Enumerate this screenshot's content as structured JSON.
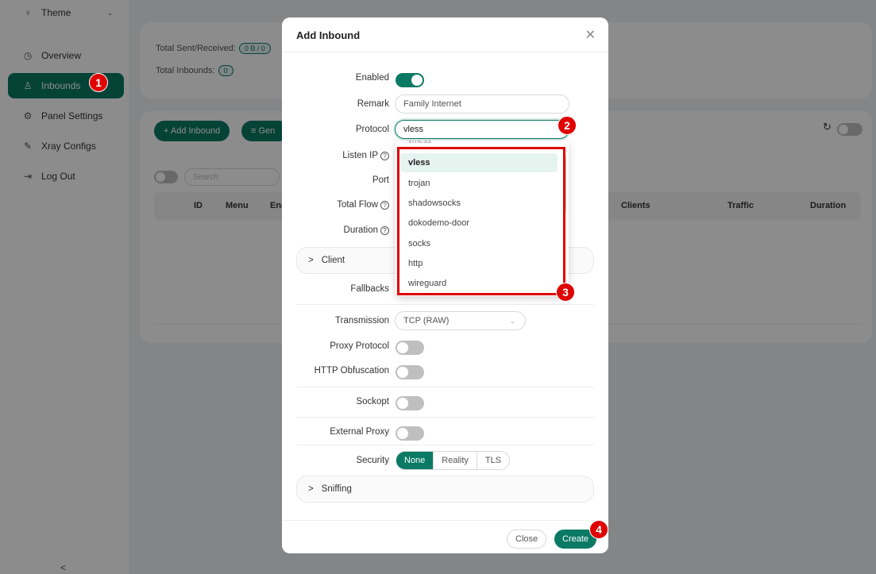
{
  "sidebar": {
    "items": [
      {
        "label": "Theme",
        "icon": "bulb-icon"
      },
      {
        "label": "Overview",
        "icon": "dashboard-icon"
      },
      {
        "label": "Inbounds",
        "icon": "user-icon"
      },
      {
        "label": "Panel Settings",
        "icon": "gear-icon"
      },
      {
        "label": "Xray Configs",
        "icon": "tool-icon"
      },
      {
        "label": "Log Out",
        "icon": "logout-icon"
      }
    ],
    "collapse": "<"
  },
  "stats": {
    "sent_label": "Total Sent/Received:",
    "sent_value": "0 B / 0",
    "inbounds_label": "Total Inbounds:",
    "inbounds_value": "0"
  },
  "toolbar": {
    "add_inbound": "+ Add Inbound",
    "general": "≡ Gen",
    "search_placeholder": "Search"
  },
  "table": {
    "columns": [
      "ID",
      "Menu",
      "Ena",
      "Clients",
      "Traffic",
      "Duration"
    ]
  },
  "modal": {
    "title": "Add Inbound",
    "fields": {
      "enabled": "Enabled",
      "remark": "Remark",
      "remark_value": "Family Internet",
      "protocol": "Protocol",
      "protocol_value": "vless",
      "listen_ip": "Listen IP",
      "port": "Port",
      "total_flow": "Total Flow",
      "duration": "Duration",
      "fallbacks": "Fallbacks",
      "transmission": "Transmission",
      "transmission_value": "TCP (RAW)",
      "proxy_protocol": "Proxy Protocol",
      "http_obfuscation": "HTTP Obfuscation",
      "sockopt": "Sockopt",
      "external_proxy": "External Proxy",
      "security": "Security"
    },
    "client_section": "Client",
    "sniffing_section": "Sniffing",
    "security_options": [
      "None",
      "Reality",
      "TLS"
    ],
    "close_button": "Close",
    "create_button": "Create"
  },
  "dropdown": {
    "partial_top": "vmess",
    "options": [
      "vless",
      "trojan",
      "shadowsocks",
      "dokodemo-door",
      "socks",
      "http",
      "wireguard"
    ],
    "selected": "vless"
  },
  "annotations": [
    "1",
    "2",
    "3",
    "4"
  ],
  "colors": {
    "accent": "#0a7a64",
    "annotation": "#e00000"
  }
}
